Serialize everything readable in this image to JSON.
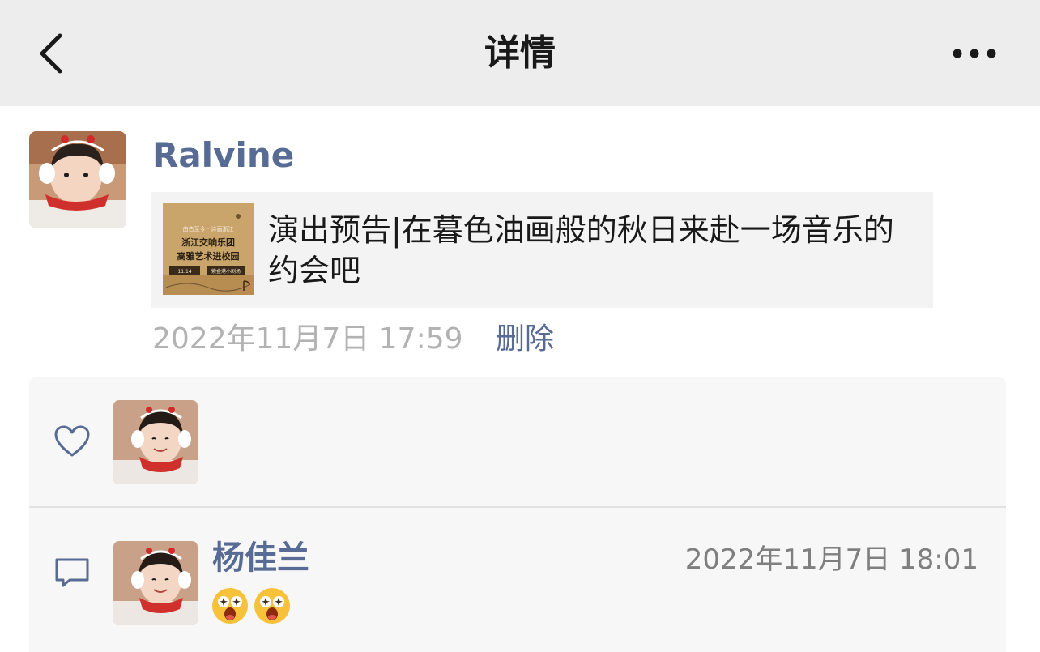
{
  "navbar": {
    "back_icon": "chevron-left-icon",
    "title": "详情",
    "more_icon": "more-dots-icon"
  },
  "post": {
    "author": "Ralvine",
    "link_card": {
      "title": "演出预告|在暮色油画般的秋日来赴一场音乐的约会吧",
      "thumbnail": {
        "top_text": "由古至今 · 诗画浙江",
        "line1": "浙江交响乐团",
        "line2": "高雅艺术进校园",
        "left_tag": "11.14",
        "right_tag": "紫金港小剧场"
      }
    },
    "time": "2022年11月7日 17:59",
    "delete_label": "删除"
  },
  "likes": {
    "icon": "heart-outline-icon"
  },
  "comments": {
    "icon": "comment-bubble-icon",
    "items": [
      {
        "name": "杨佳兰",
        "time": "2022年11月7日 18:01",
        "emojis": [
          "star-struck-emoji",
          "star-struck-emoji"
        ]
      }
    ]
  },
  "colors": {
    "navbar_bg": "#ededed",
    "link_blue": "#576b95",
    "panel_bg": "#f7f7f7",
    "card_bg": "#f3f3f3",
    "thumb_bg": "#c9a56c"
  }
}
